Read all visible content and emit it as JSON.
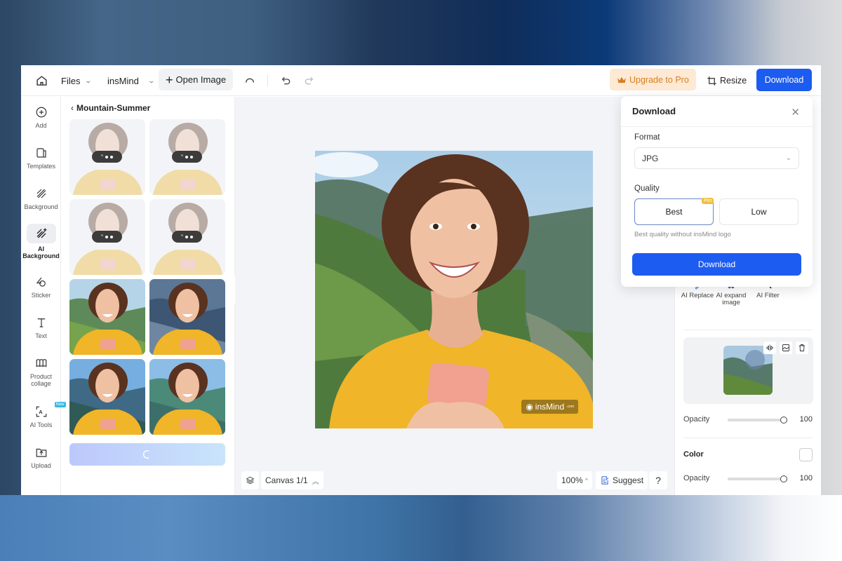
{
  "topbar": {
    "files_label": "Files",
    "project_label": "insMind",
    "open_image_label": "Open Image",
    "upgrade_label": "Upgrade to Pro",
    "resize_label": "Resize",
    "download_label": "Download"
  },
  "rail": {
    "items": [
      {
        "label": "Add",
        "icon": "plus-circle-icon"
      },
      {
        "label": "Templates",
        "icon": "templates-icon"
      },
      {
        "label": "Background",
        "icon": "hatch-icon"
      },
      {
        "label": "AI Background",
        "icon": "ai-hatch-icon",
        "active": true
      },
      {
        "label": "Sticker",
        "icon": "sticker-icon"
      },
      {
        "label": "Text",
        "icon": "text-icon"
      },
      {
        "label": "Product collage",
        "icon": "collage-icon"
      },
      {
        "label": "AI Tools",
        "icon": "ai-tools-icon",
        "badge": "New"
      },
      {
        "label": "Upload",
        "icon": "upload-icon"
      }
    ]
  },
  "panel": {
    "title": "Mountain-Summer",
    "thumbnails": [
      {
        "state": "loading"
      },
      {
        "state": "loading"
      },
      {
        "state": "loading"
      },
      {
        "state": "loading"
      },
      {
        "state": "ready",
        "scene": "green-mountains"
      },
      {
        "state": "ready",
        "scene": "rocky-shore"
      },
      {
        "state": "ready",
        "scene": "sunlit-mountains"
      },
      {
        "state": "ready",
        "scene": "valley-clouds"
      }
    ],
    "generate_state": "loading"
  },
  "canvas": {
    "watermark": "insMind",
    "watermark_suffix": ".com",
    "canvas_label": "Canvas 1/1",
    "zoom_label": "100%",
    "suggest_label": "Suggest",
    "help_label": "?"
  },
  "right_panel": {
    "ai_tools": [
      {
        "label": "AI Replace"
      },
      {
        "label": "AI expand image"
      },
      {
        "label": "AI Filter"
      }
    ],
    "layer_opacity_label": "Opacity",
    "layer_opacity_value": "100",
    "layer_opacity_fraction": 1.0,
    "color_label": "Color",
    "color_value": "#ffffff",
    "color_opacity_label": "Opacity",
    "color_opacity_value": "100",
    "color_opacity_fraction": 1.0
  },
  "download_popup": {
    "title": "Download",
    "format_label": "Format",
    "format_value": "JPG",
    "quality_label": "Quality",
    "quality_options": [
      "Best",
      "Low"
    ],
    "quality_selected": "Best",
    "pro_tag": "Pro",
    "note": "Best quality without insMind logo",
    "download_button": "Download"
  },
  "colors": {
    "accent": "#1d5cf0",
    "upgrade_bg": "#fde9d4",
    "upgrade_text": "#d7801e"
  }
}
